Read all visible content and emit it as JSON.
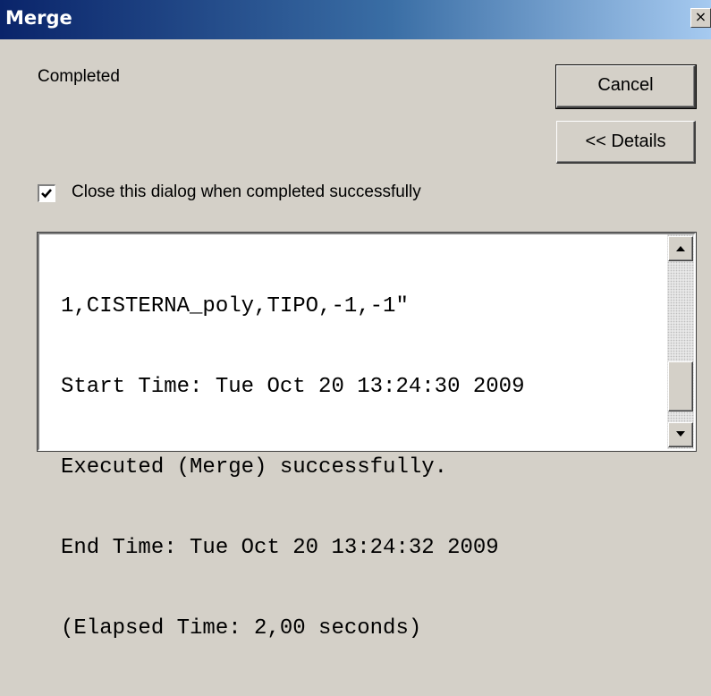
{
  "window": {
    "title": "Merge",
    "close_glyph": "×"
  },
  "status": "Completed",
  "buttons": {
    "cancel": "Cancel",
    "details": "<< Details"
  },
  "close_on_complete": {
    "label": "Close this dialog when completed successfully",
    "checked": true
  },
  "log": {
    "lines": [
      "1,CISTERNA_poly,TIPO,-1,-1\"",
      "Start Time: Tue Oct 20 13:24:30 2009",
      "Executed (Merge) successfully.",
      "End Time: Tue Oct 20 13:24:32 2009",
      "(Elapsed Time: 2,00 seconds)"
    ]
  },
  "icons": {
    "close": "close-icon",
    "check": "checkmark-icon",
    "scroll_up": "arrow-up-icon",
    "scroll_down": "arrow-down-icon"
  },
  "colors": {
    "titlebar_start": "#0a246a",
    "titlebar_end": "#a6caf0",
    "dialog_face": "#d4d0c8"
  }
}
